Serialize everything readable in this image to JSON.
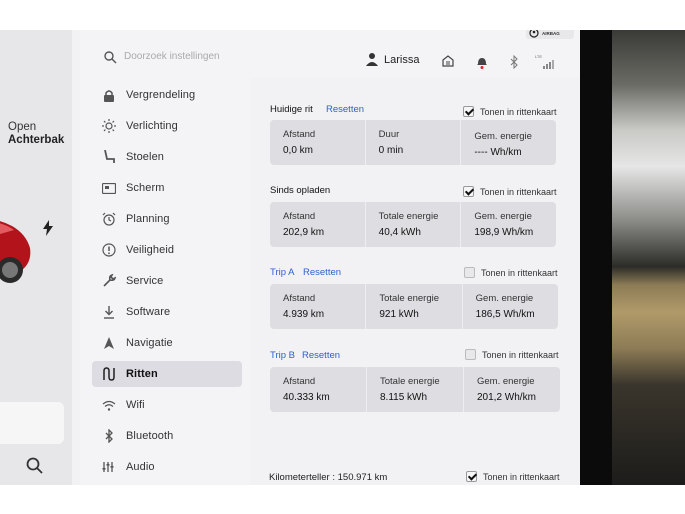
{
  "topbar": {
    "search_placeholder": "Doorzoek instellingen",
    "user_name": "Larissa",
    "airbag_label": "AIRBAG",
    "lte_label": "LTE"
  },
  "car_panel": {
    "open_label": "Open",
    "trunk_label": "Achterbak"
  },
  "nav": {
    "items": [
      {
        "label": "Vergrendeling",
        "icon": "lock-icon"
      },
      {
        "label": "Verlichting",
        "icon": "sun-icon"
      },
      {
        "label": "Stoelen",
        "icon": "seat-icon"
      },
      {
        "label": "Scherm",
        "icon": "display-icon"
      },
      {
        "label": "Planning",
        "icon": "alarm-clock-icon"
      },
      {
        "label": "Veiligheid",
        "icon": "alert-circle-icon"
      },
      {
        "label": "Service",
        "icon": "wrench-icon"
      },
      {
        "label": "Software",
        "icon": "download-icon"
      },
      {
        "label": "Navigatie",
        "icon": "navigation-arrow-icon"
      },
      {
        "label": "Ritten",
        "icon": "trip-icon",
        "active": true
      },
      {
        "label": "Wifi",
        "icon": "wifi-icon"
      },
      {
        "label": "Bluetooth",
        "icon": "bluetooth-icon"
      },
      {
        "label": "Audio",
        "icon": "equalizer-icon"
      }
    ]
  },
  "trips": {
    "current": {
      "title": "Huidige rit",
      "reset": "Resetten",
      "show_label": "Tonen in rittenkaart",
      "checked": true,
      "cols": [
        {
          "label": "Afstand",
          "value": "0,0 km"
        },
        {
          "label": "Duur",
          "value": "0 min"
        },
        {
          "label": "Gem. energie",
          "value": "---- Wh/km"
        }
      ]
    },
    "since_charge": {
      "title": "Sinds opladen",
      "show_label": "Tonen in rittenkaart",
      "checked": true,
      "cols": [
        {
          "label": "Afstand",
          "value": "202,9 km"
        },
        {
          "label": "Totale energie",
          "value": "40,4 kWh"
        },
        {
          "label": "Gem. energie",
          "value": "198,9 Wh/km"
        }
      ]
    },
    "trip_a": {
      "title": "Trip A",
      "reset": "Resetten",
      "show_label": "Tonen in rittenkaart",
      "checked": false,
      "cols": [
        {
          "label": "Afstand",
          "value": "4.939 km"
        },
        {
          "label": "Totale energie",
          "value": "921 kWh"
        },
        {
          "label": "Gem. energie",
          "value": "186,5 Wh/km"
        }
      ]
    },
    "trip_b": {
      "title": "Trip B",
      "reset": "Resetten",
      "show_label": "Tonen in rittenkaart",
      "checked": false,
      "cols": [
        {
          "label": "Afstand",
          "value": "40.333 km"
        },
        {
          "label": "Totale energie",
          "value": "8.115 kWh"
        },
        {
          "label": "Gem. energie",
          "value": "201,2 Wh/km"
        }
      ]
    },
    "odometer": {
      "label": "Kilometerteller :  150.971 km",
      "show_label": "Tonen in rittenkaart",
      "checked": true
    }
  },
  "colors": {
    "accent": "#2d5fd0",
    "car": "#b3141c",
    "notification": "#e0202a"
  }
}
